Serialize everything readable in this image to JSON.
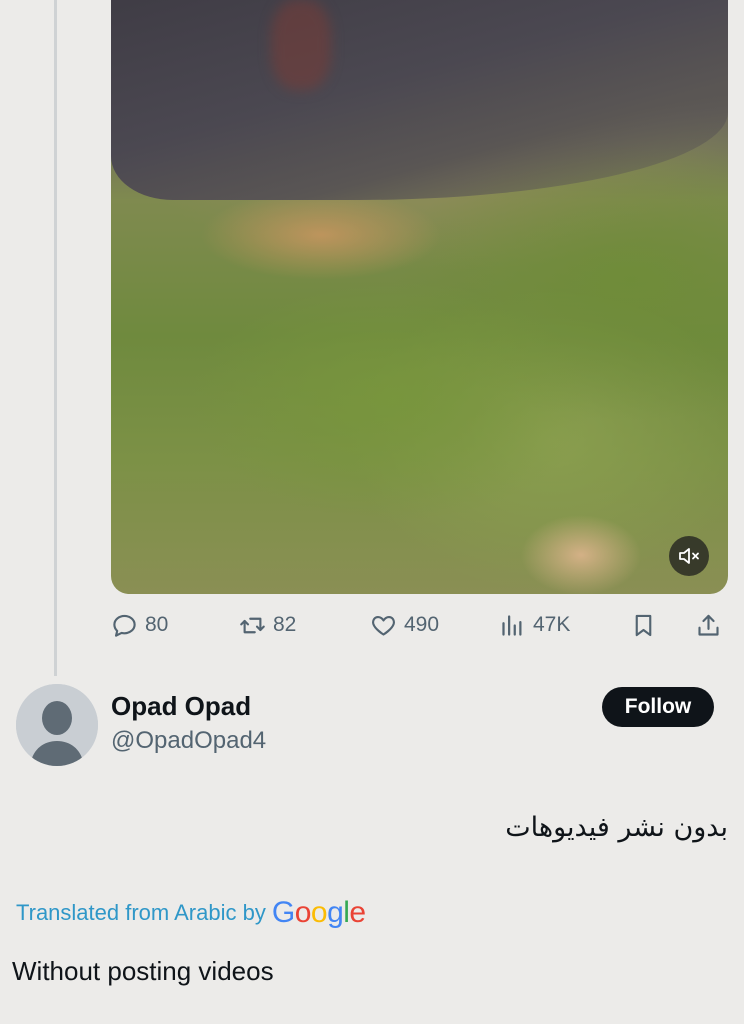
{
  "tweet_actions": {
    "replies": "80",
    "retweets": "82",
    "likes": "490",
    "views": "47K"
  },
  "profile": {
    "display_name": "Opad Opad",
    "handle": "@OpadOpad4",
    "follow_label": "Follow"
  },
  "post": {
    "original_text": "بدون نشر فيديوهات",
    "translated_prefix": "Translated from Arabic by",
    "translation_provider": "Google",
    "translation_text": "Without posting videos"
  },
  "colors": {
    "muted_text": "#536471",
    "primary_text": "#0f1419",
    "link_blue": "#1d9bf0",
    "background": "#ecebe9"
  },
  "icons": {
    "reply": "reply-icon",
    "retweet": "retweet-icon",
    "like": "heart-icon",
    "views": "views-chart-icon",
    "bookmark": "bookmark-icon",
    "share": "share-icon",
    "mute": "muted-speaker-icon"
  }
}
